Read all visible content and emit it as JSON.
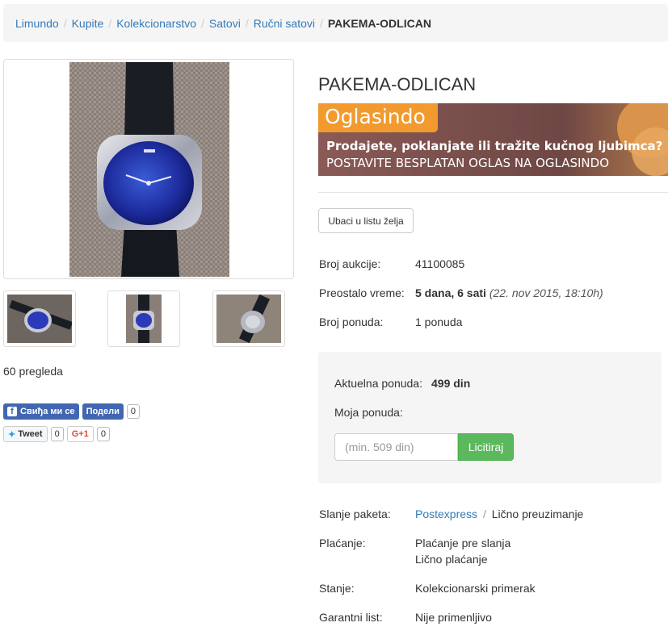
{
  "breadcrumb": {
    "items": [
      "Limundo",
      "Kupite",
      "Kolekcionarstvo",
      "Satovi",
      "Ručni satovi"
    ],
    "current": "PAKEMA-ODLICAN",
    "separator": "/"
  },
  "gallery": {
    "views": "60 pregleda"
  },
  "social": {
    "fb_like": "Свиђа ми се",
    "fb_share": "Подели",
    "fb_count": "0",
    "tweet": "Tweet",
    "tweet_count": "0",
    "gplus": "G+1",
    "gplus_count": "0"
  },
  "product": {
    "title": "PAKEMA-ODLICAN"
  },
  "banner": {
    "brand": "Oglasindo",
    "line1": "Prodajete, poklanjate ili tražite kučnog ljubimca?",
    "line2": "POSTAVITE BESPLATAN OGLAS NA OGLASINDO"
  },
  "wishlist_button": "Ubaci u listu želja",
  "auction": {
    "id_label": "Broj aukcije:",
    "id_value": "41100085",
    "time_label": "Preostalo vreme:",
    "time_value": "5 dana, 6 sati",
    "time_date": "(22. nov 2015, 18:10h)",
    "bids_label": "Broj ponuda:",
    "bids_value": "1 ponuda"
  },
  "bid": {
    "current_label": "Aktuelna ponuda:",
    "current_value": "499 din",
    "my_bid_label": "Moja ponuda:",
    "input_placeholder": "(min. 509 din)",
    "submit_label": "Licitiraj"
  },
  "details": {
    "shipping_label": "Slanje paketa:",
    "shipping_link": "Postexpress",
    "shipping_sep": "/",
    "shipping_other": "Lično preuzimanje",
    "payment_label": "Plaćanje:",
    "payment_1": "Plaćanje pre slanja",
    "payment_2": "Lično plaćanje",
    "condition_label": "Stanje:",
    "condition_value": "Kolekcionarski primerak",
    "warranty_label": "Garantni list:",
    "warranty_value": "Nije primenljivo"
  },
  "colors": {
    "link": "#337ab7",
    "button_green": "#5cb85c",
    "fb_blue": "#4267b2",
    "banner_orange": "#f29a2e",
    "banner_brown": "#7a4a45"
  }
}
